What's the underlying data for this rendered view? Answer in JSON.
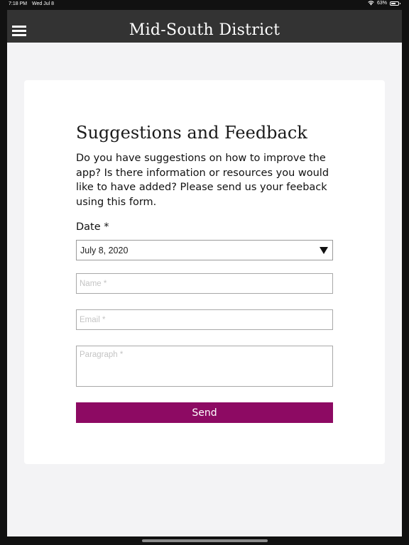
{
  "status_bar": {
    "time": "7:18 PM",
    "date": "Wed Jul 8",
    "battery": "63%",
    "battery_level": 0.63,
    "wifi_icon": "wifi-icon",
    "battery_icon": "battery-icon"
  },
  "nav": {
    "title": "Mid-South District",
    "menu_icon": "hamburger-menu-icon"
  },
  "form": {
    "title": "Suggestions and Feedback",
    "description": "Do you have suggestions on how to improve the app? Is there information or resources you would like to have added? Please send us your feeback using this form.",
    "date_label": "Date *",
    "date_value": "July 8, 2020",
    "name_placeholder": "Name *",
    "email_placeholder": "Email *",
    "paragraph_placeholder": "Paragraph *",
    "send_label": "Send"
  },
  "colors": {
    "nav_background": "#333333",
    "page_background": "#f3f3f5",
    "card_background": "#ffffff",
    "send_button": "#8d0a63"
  }
}
